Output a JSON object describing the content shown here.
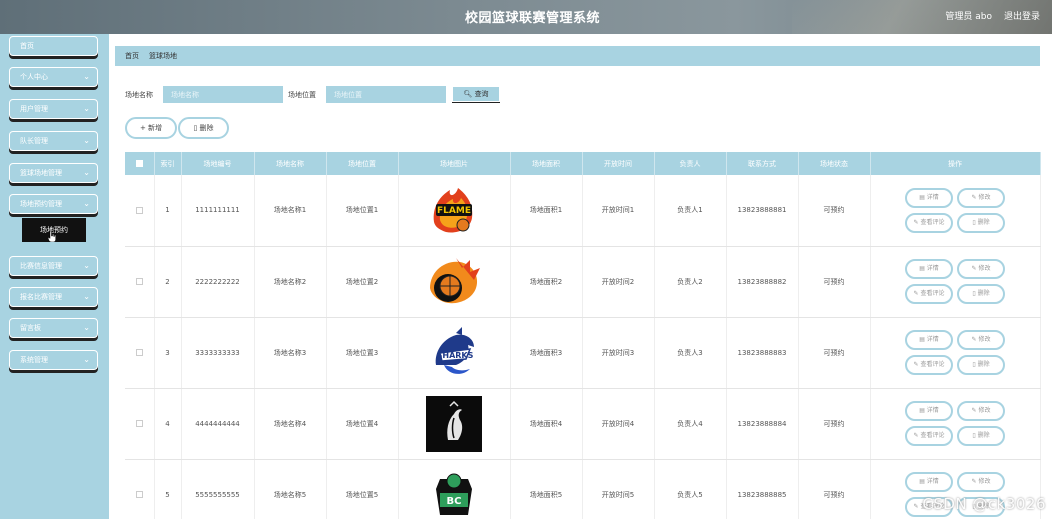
{
  "header": {
    "title": "校园篮球联赛管理系统",
    "admin": "管理员 abo",
    "logout": "退出登录"
  },
  "sidebar": {
    "items": [
      {
        "label": "首页",
        "chevron": false
      },
      {
        "label": "个人中心",
        "chevron": true
      },
      {
        "label": "用户管理",
        "chevron": true
      },
      {
        "label": "队长管理",
        "chevron": true
      },
      {
        "label": "篮球场地管理",
        "chevron": true
      },
      {
        "label": "场地预约管理",
        "chevron": true
      },
      {
        "label": "比赛信息管理",
        "chevron": true
      },
      {
        "label": "报名比赛管理",
        "chevron": true
      },
      {
        "label": "留言板",
        "chevron": true
      },
      {
        "label": "系统管理",
        "chevron": true
      }
    ],
    "submenu": "场地预约"
  },
  "breadcrumb": [
    "首页",
    "篮球场地"
  ],
  "search": {
    "name_label": "场地名称",
    "name_placeholder": "场地名称",
    "location_label": "场地位置",
    "location_placeholder": "场地位置",
    "query_button": "查询"
  },
  "actions": {
    "add": "新增",
    "delete": "删除"
  },
  "table": {
    "columns": [
      "索引",
      "场地编号",
      "场地名称",
      "场地位置",
      "场地图片",
      "场地面积",
      "开放时间",
      "负责人",
      "联系方式",
      "场地状态",
      "操作"
    ],
    "rows": [
      {
        "index": "1",
        "code": "1111111111",
        "name": "场地名称1",
        "location": "场地位置1",
        "area": "场地面积1",
        "open_time": "开放时间1",
        "manager": "负责人1",
        "phone": "13823888881",
        "status": "可预约"
      },
      {
        "index": "2",
        "code": "2222222222",
        "name": "场地名称2",
        "location": "场地位置2",
        "area": "场地面积2",
        "open_time": "开放时间2",
        "manager": "负责人2",
        "phone": "13823888882",
        "status": "可预约"
      },
      {
        "index": "3",
        "code": "3333333333",
        "name": "场地名称3",
        "location": "场地位置3",
        "area": "场地面积3",
        "open_time": "开放时间3",
        "manager": "负责人3",
        "phone": "13823888883",
        "status": "可预约"
      },
      {
        "index": "4",
        "code": "4444444444",
        "name": "场地名称4",
        "location": "场地位置4",
        "area": "场地面积4",
        "open_time": "开放时间4",
        "manager": "负责人4",
        "phone": "13823888884",
        "status": "可预约"
      },
      {
        "index": "5",
        "code": "5555555555",
        "name": "场地名称5",
        "location": "场地位置5",
        "area": "场地面积5",
        "open_time": "开放时间5",
        "manager": "负责人5",
        "phone": "13823888885",
        "status": "可预约"
      }
    ],
    "op_labels": {
      "detail": "详情",
      "edit": "修改",
      "review": "查看评论",
      "delete": "删除"
    }
  },
  "logo_icons": [
    "flame-team-logo",
    "flaming-basketball-logo",
    "shark-team-logo",
    "knight-logo",
    "basketball-team-logo"
  ],
  "watermark": "CSDN @ck3026",
  "colors": {
    "accent": "#a8d3e1",
    "header": "#7d8b92",
    "submenu": "#111111"
  }
}
